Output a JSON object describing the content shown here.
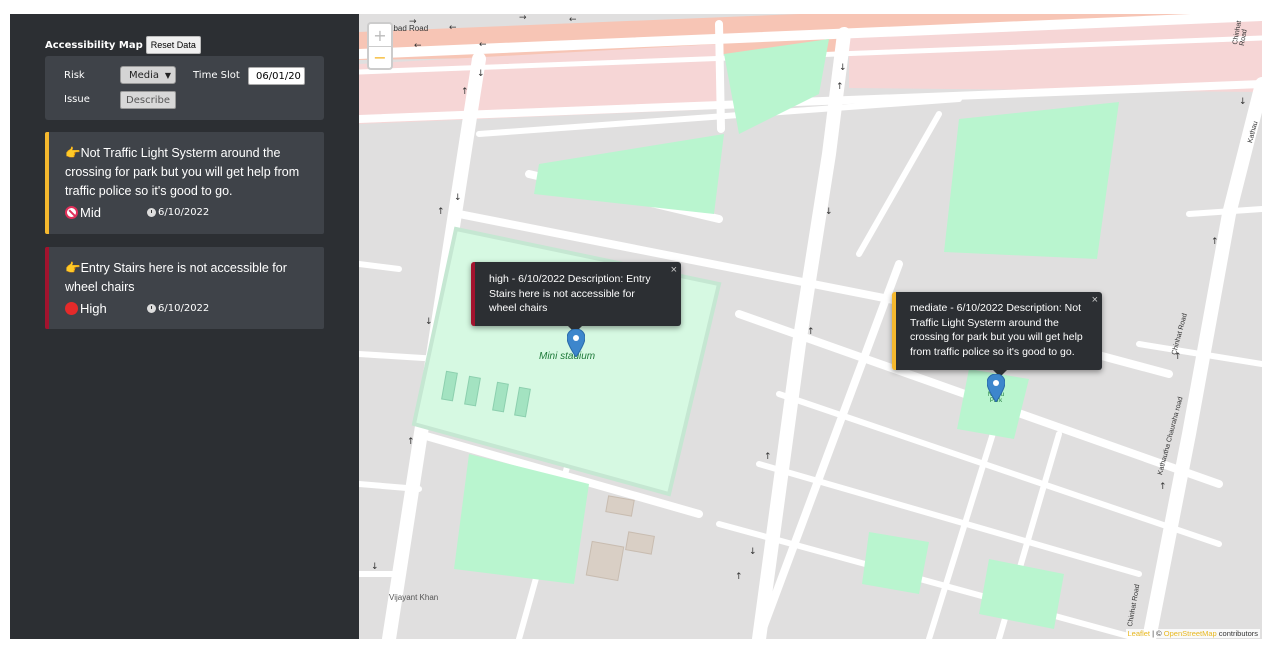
{
  "sidebar": {
    "title": "Accessibility Map",
    "reset_label": "Reset Data",
    "form": {
      "risk_label": "Risk",
      "risk_value": "Media",
      "time_slot_label": "Time Slot",
      "time_slot_value": "06/01/20",
      "issue_label": "Issue",
      "issue_placeholder": "Describe"
    },
    "issues": [
      {
        "text": "👉Not Traffic Light Systerm around the crossing for park but you will get help from traffic police so it's good to go.",
        "risk": "Mid",
        "date": "6/10/2022",
        "color": "#f5b82e"
      },
      {
        "text": "👉Entry Stairs here is not accessible for wheel chairs",
        "risk": "High",
        "date": "6/10/2022",
        "color": "#a2132e"
      }
    ]
  },
  "map": {
    "zoom_in": "+",
    "zoom_out": "−",
    "labels": {
      "road_top": "abad Road",
      "mini_stadium": "Mini stadium",
      "vijayant": "Vijayant Khan",
      "park": "Nehru Park",
      "chinhat_road_1": "Chinhat Road",
      "chinhat_road_2": "Chinhat Road",
      "chinhat_road_3": "Chinhat Road",
      "kathautha": "Kathautha Chauraha road",
      "kathau_top": "Kathau"
    },
    "popups": [
      {
        "text": "high - 6/10/2022 Description: Entry Stairs here is not accessible for wheel chairs",
        "close": "×"
      },
      {
        "text": "mediate - 6/10/2022 Description: Not Traffic Light Systerm around the crossing for park but you will get help from traffic police so it's good to go.",
        "close": "×"
      }
    ],
    "attribution": {
      "leaflet": "Leaflet",
      "separator": " | © ",
      "osm": "OpenStreetMap",
      "contributors": " contributors"
    }
  },
  "colors": {
    "sidebar_bg": "#2c2f33",
    "panel_bg": "#3f4349",
    "mid_accent": "#f5b82e",
    "high_accent": "#a2132e",
    "marker_blue": "#3d86cc"
  }
}
